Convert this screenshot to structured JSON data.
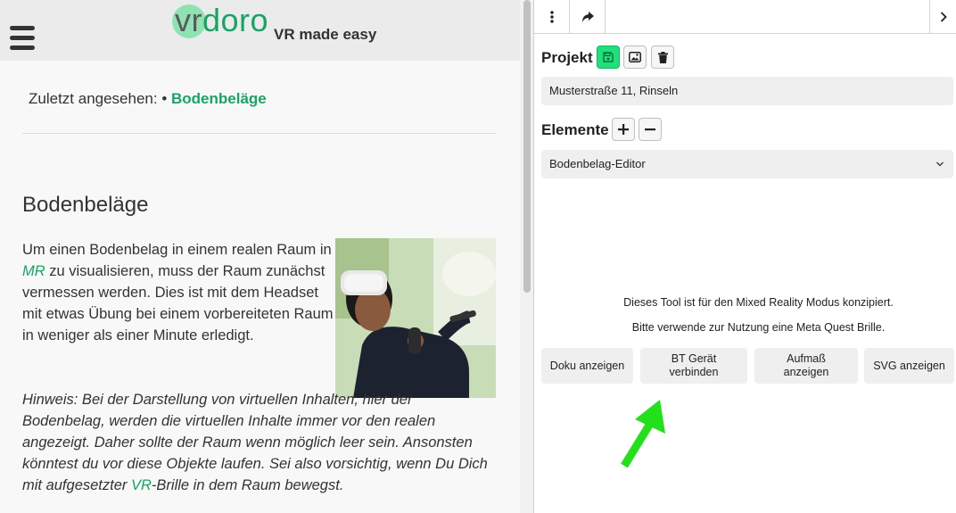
{
  "header": {
    "logo_vr": "vr",
    "logo_rest": "doro",
    "tagline": "VR made easy"
  },
  "recent": {
    "prefix": "Zuletzt angesehen: •",
    "link": "Bodenbeläge"
  },
  "article": {
    "title": "Bodenbeläge",
    "p1_a": "Um einen Bodenbelag in einem realen Raum in ",
    "p1_link": "MR",
    "p1_b": " zu visualisieren, muss der Raum zunächst vermessen werden. Dies ist mit dem Headset mit etwas Übung bei einem vorbereiteten Raum in weniger als einer Minute erledigt.",
    "p2_a": "Hinweis: Bei der Darstellung von virtuellen Inhalten, hier der Bodenbelag, werden die virtuellen Inhalte immer vor den realen angezeigt. Daher sollte der Raum wenn möglich leer sein. Ansonsten könntest du vor diese Objekte laufen. Sei also vorsichtig, wenn Du Dich mit aufgesetzter ",
    "p2_link": "VR",
    "p2_b": "-Brille in dem Raum bewegst."
  },
  "panel": {
    "project_label": "Projekt",
    "project_value": "Musterstraße 11, Rinseln",
    "elements_label": "Elemente",
    "element_selected": "Bodenbelag-Editor",
    "info_line1": "Dieses Tool ist für den Mixed Reality Modus konzipiert.",
    "info_line2": "Bitte verwende zur Nutzung eine Meta Quest Brille.",
    "actions": {
      "doku": "Doku anzeigen",
      "bt": "BT Gerät verbinden",
      "aufmass": "Aufmaß anzeigen",
      "svg": "SVG anzeigen"
    }
  },
  "icons": {
    "menu": "hamburger-icon",
    "more": "more-vertical-icon",
    "share": "share-arrow-icon",
    "collapse": "chevron-right-icon",
    "save": "save-icon",
    "image": "image-icon",
    "delete": "trash-icon",
    "add": "plus-icon",
    "remove": "minus-icon",
    "select": "chevron-down-icon",
    "annotation": "green-arrow-icon"
  },
  "colors": {
    "brand_green": "#1aa364",
    "save_button": "#20e07c",
    "annotation_arrow": "#22e01a"
  }
}
